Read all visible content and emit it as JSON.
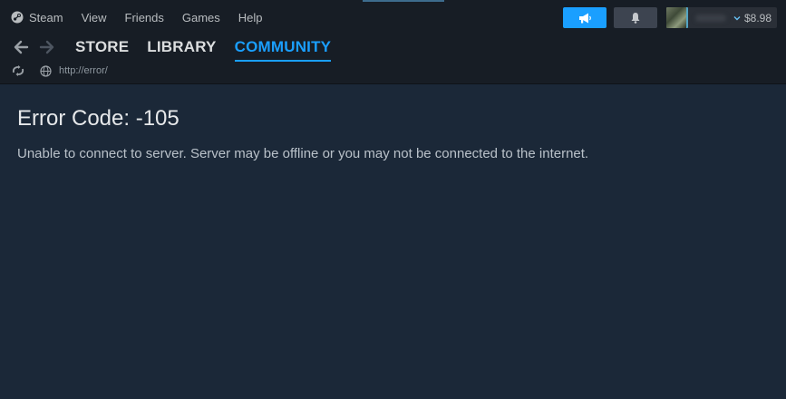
{
  "menubar": {
    "items": [
      {
        "label": "Steam",
        "icon": "steam-logo-icon"
      },
      {
        "label": "View"
      },
      {
        "label": "Friends"
      },
      {
        "label": "Games"
      },
      {
        "label": "Help"
      }
    ]
  },
  "account": {
    "balance": "$8.98"
  },
  "nav": {
    "tabs": [
      {
        "label": "STORE"
      },
      {
        "label": "LIBRARY"
      },
      {
        "label": "COMMUNITY",
        "active": true
      }
    ]
  },
  "address": {
    "url": "http://error/"
  },
  "content": {
    "title": "Error Code: -105",
    "message": "Unable to connect to server. Server may be offline or you may not be connected to the internet."
  },
  "colors": {
    "accent": "#1a9fff",
    "background": "#1b2838",
    "chrome": "#171d25"
  }
}
